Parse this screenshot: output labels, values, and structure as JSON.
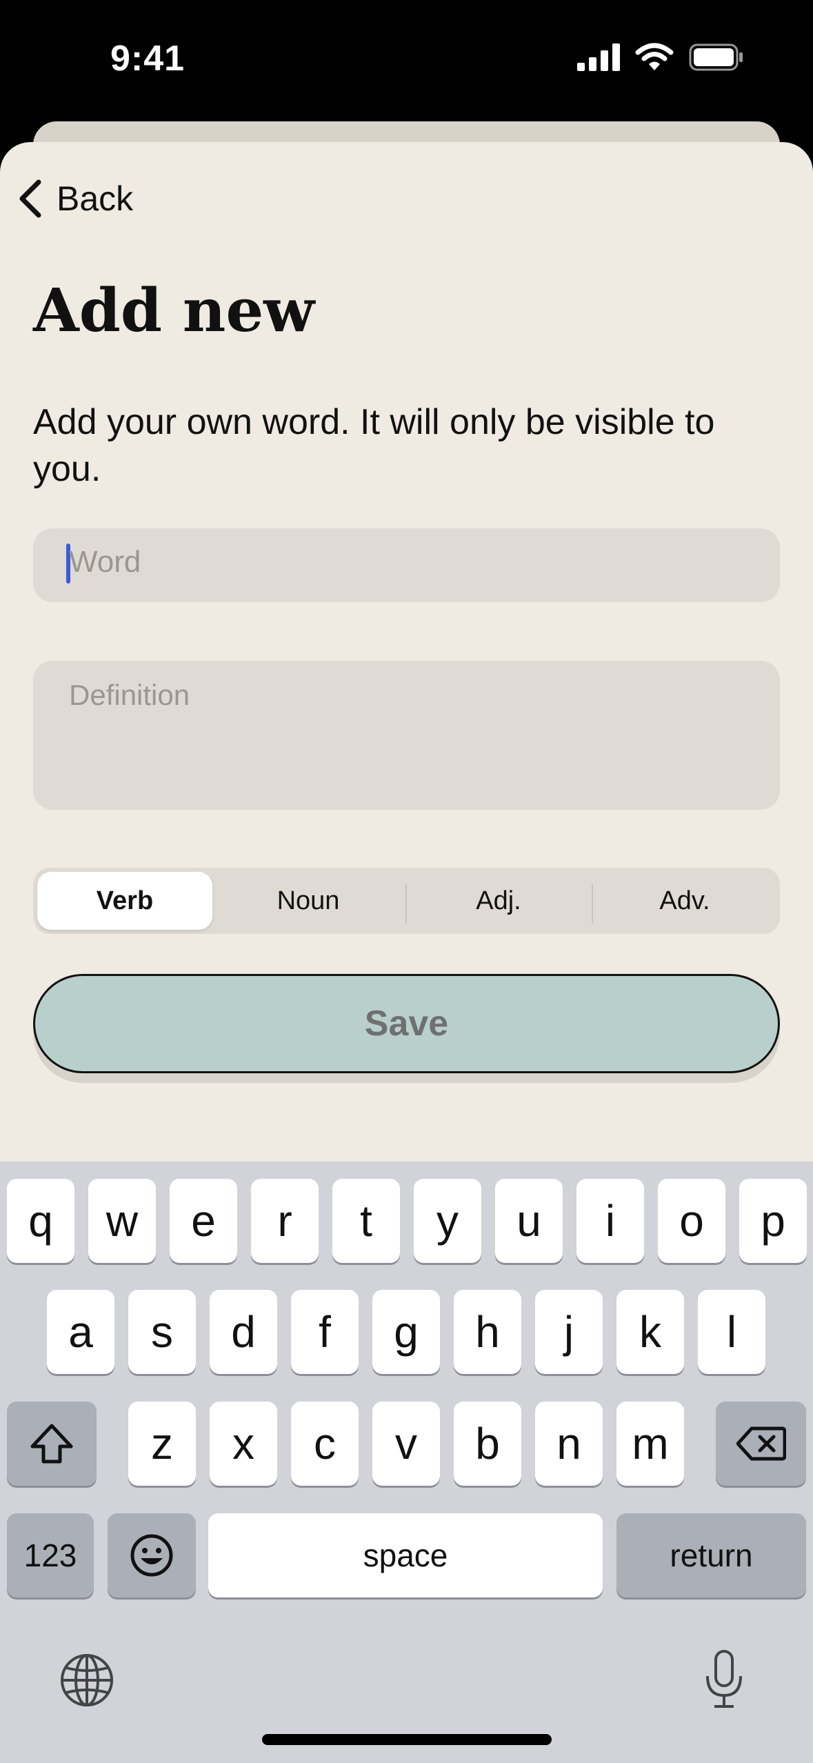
{
  "status_bar": {
    "time": "9:41"
  },
  "nav": {
    "back_label": "Back"
  },
  "page": {
    "title": "Add new",
    "description": "Add your own word. It will only be visible to you."
  },
  "form": {
    "word_placeholder": "Word",
    "word_value": "",
    "definition_placeholder": "Definition",
    "definition_value": ""
  },
  "part_of_speech": {
    "options": [
      "Verb",
      "Noun",
      "Adj.",
      "Adv."
    ],
    "selected": "Verb"
  },
  "save": {
    "label": "Save"
  },
  "keyboard": {
    "row1": [
      "q",
      "w",
      "e",
      "r",
      "t",
      "y",
      "u",
      "i",
      "o",
      "p"
    ],
    "row2": [
      "a",
      "s",
      "d",
      "f",
      "g",
      "h",
      "j",
      "k",
      "l"
    ],
    "row3": [
      "z",
      "x",
      "c",
      "v",
      "b",
      "n",
      "m"
    ],
    "numbers_label": "123",
    "space_label": "space",
    "return_label": "return",
    "icons": [
      "shift-icon",
      "delete-icon",
      "emoji-icon",
      "globe-icon",
      "microphone-icon"
    ]
  },
  "colors": {
    "sheet_bg": "#efebe2",
    "field_bg": "#dfdbd4",
    "save_bg": "#b9cfcb",
    "caret": "#3b5bdb",
    "keyboard_bg": "#d1d3d9"
  }
}
